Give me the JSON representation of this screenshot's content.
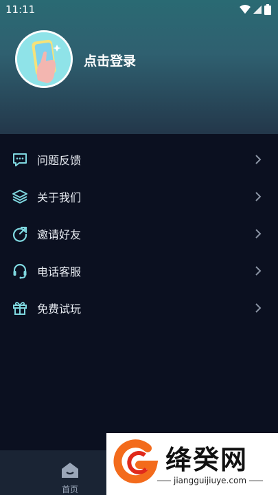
{
  "status_bar": {
    "time": "11:11",
    "icons": [
      "wifi-icon",
      "signal-icon",
      "battery-icon"
    ]
  },
  "profile": {
    "login_label": "点击登录",
    "avatar_icon": "hand-phone-avatar"
  },
  "menu": {
    "items": [
      {
        "label": "问题反馈",
        "icon": "chat-feedback-icon"
      },
      {
        "label": "关于我们",
        "icon": "layers-icon"
      },
      {
        "label": "邀请好友",
        "icon": "refresh-share-icon"
      },
      {
        "label": "电话客服",
        "icon": "headset-icon"
      },
      {
        "label": "免费试玩",
        "icon": "gift-icon"
      }
    ]
  },
  "tabbar": {
    "home_label": "首页"
  },
  "watermark": {
    "brand": "绛癸网",
    "url": "jiangguijiuye.com"
  },
  "colors": {
    "background": "#0b1020",
    "accent_icon": "#7fd8e0",
    "header_top": "#2a6a73"
  }
}
